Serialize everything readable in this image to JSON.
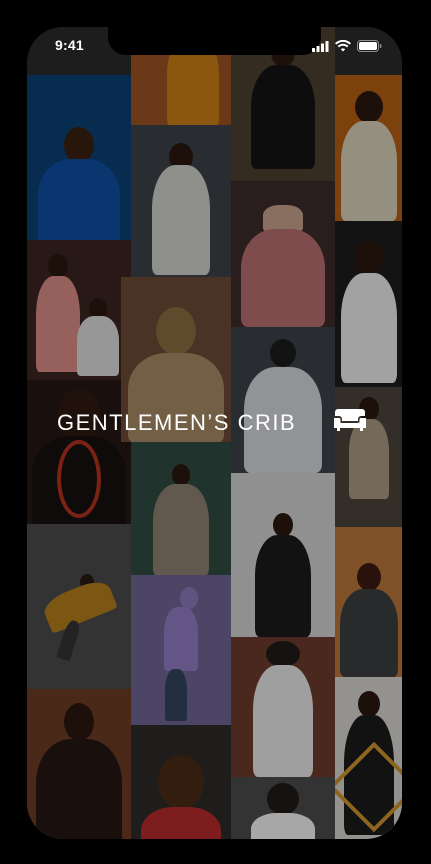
{
  "status_bar": {
    "time": "9:41",
    "icons": [
      "signal-icon",
      "wifi-icon",
      "battery-icon"
    ]
  },
  "brand": {
    "title": "GENTLEMEN’S CRIB",
    "icon": "sofa-icon"
  },
  "colors": {
    "background": "#000000",
    "text": "#ffffff",
    "accent_gold": "#c9912b"
  },
  "gallery": {
    "photos": [
      "photo-blue-agbada",
      "photo-white-hoodie",
      "photo-pink-hat",
      "photo-orange-sunglasses",
      "photo-pink-kaftan",
      "photo-blonde-man",
      "photo-denim-shirt",
      "photo-white-tee",
      "photo-coral-beads",
      "photo-trench-coat",
      "photo-black-suit",
      "photo-seated-chair",
      "photo-dancer",
      "photo-purple-hoodie",
      "photo-white-shirt-hat",
      "photo-leather-jacket",
      "photo-praying-hands",
      "photo-curly-hair",
      "photo-black-hat",
      "photo-black-robe"
    ]
  }
}
